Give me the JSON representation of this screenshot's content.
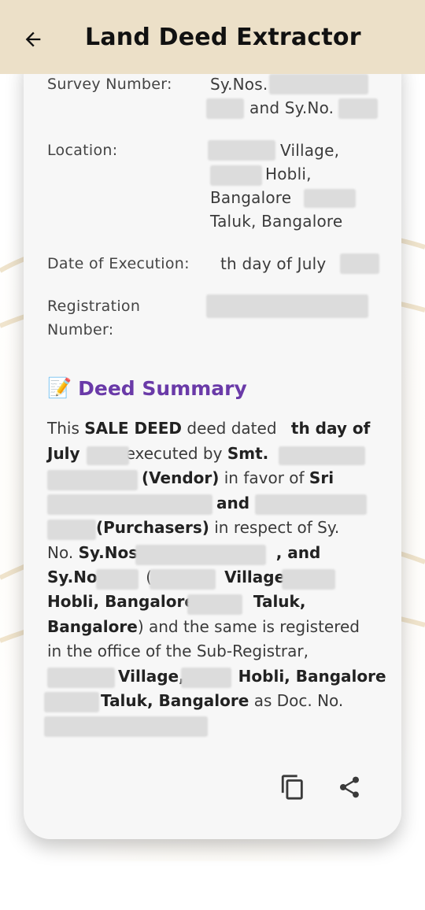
{
  "app_bar": {
    "title": "Land Deed Extractor",
    "back_icon": "arrow-back-icon",
    "background": "#ece0c8"
  },
  "details": {
    "survey_label": "Survey Number:",
    "survey_value_1": "Sy.Nos.",
    "survey_value_2": "and Sy.No.",
    "location_label": "Location:",
    "location_line_1": "Village,",
    "location_line_2": "Hobli,",
    "location_line_3": "Bangalore",
    "location_line_4": "Taluk, Bangalore",
    "date_label": "Date of Execution:",
    "date_value": "th day of July",
    "registration_label_1": "Registration",
    "registration_label_2": "Number:"
  },
  "summary": {
    "heading": "Deed Summary",
    "heading_icon": "memo-icon",
    "heading_color": "#6a3aa8",
    "lines": {
      "l1_a": "This ",
      "l1_b": "SALE DEED",
      "l1_c": " deed dated ",
      "l1_d": "th day of",
      "l2_a": "July",
      "l2_b": "executed by ",
      "l2_c": "Smt.",
      "l3_a": "(Vendor)",
      "l3_b": " in favor of ",
      "l3_c": "Sri",
      "l4_a": "and",
      "l5_a": "(Purchasers)",
      "l5_b": " in respect of Sy.",
      "l6_a": "No. ",
      "l6_b": "Sy.Nos.",
      "l6_c": ", and",
      "l7_a": "Sy.No.",
      "l7_b": "(",
      "l7_c": "Village,",
      "l8_a": "Hobli, Bangalore",
      "l8_b": "Taluk,",
      "l9_a": "Bangalore",
      "l9_b": ") and the same is registered",
      "l10_a": "in the office of the Sub-Registrar,",
      "l11_a": "Village,",
      "l11_b": "Hobli, Bangalore",
      "l12_a": "Taluk, Bangalore",
      "l12_b": " as Doc. No."
    }
  },
  "actions": {
    "copy_icon": "copy-icon",
    "share_icon": "share-icon"
  }
}
